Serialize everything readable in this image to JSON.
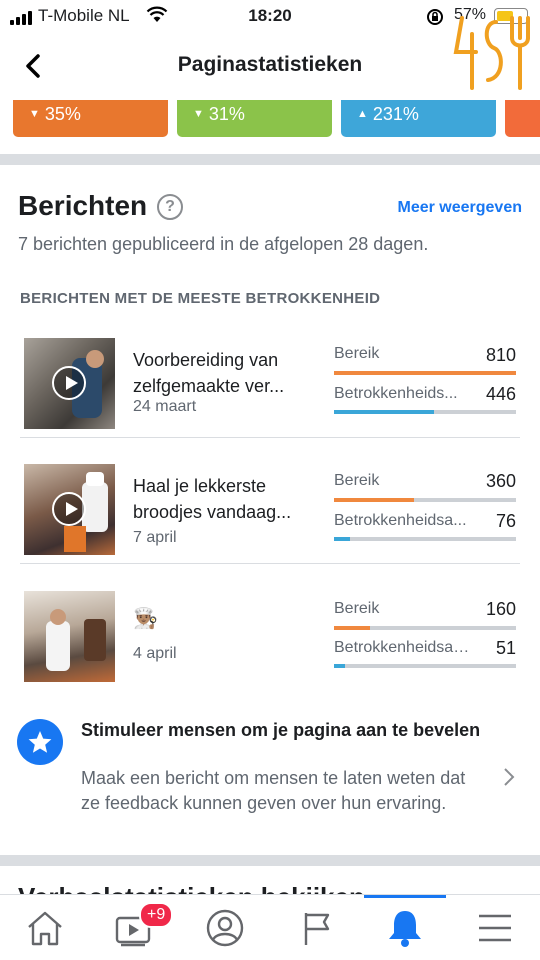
{
  "status_bar": {
    "carrier": "T-Mobile NL",
    "time": "18:20",
    "battery_percent": "57%",
    "battery_level": 0.57
  },
  "header": {
    "title": "Paginastatistieken"
  },
  "metric_chips": [
    {
      "value": "35%",
      "direction": "down",
      "color": "#e8772e"
    },
    {
      "value": "31%",
      "direction": "down",
      "color": "#8bc34a"
    },
    {
      "value": "231%",
      "direction": "up",
      "color": "#3ea6d9"
    },
    {
      "value": "",
      "direction": "",
      "color": "#f26b3a"
    }
  ],
  "posts_section": {
    "title": "Berichten",
    "more_link": "Meer weergeven",
    "subtitle": "7 berichten gepubliceerd in de afgelopen 28 dagen.",
    "top_header": "BERICHTEN MET DE MEESTE BETROKKENHEID",
    "reach_color": "#f0883e",
    "engagement_color": "#3aa6d8",
    "posts": [
      {
        "title_line1": "Voorbereiding van",
        "title_line2": "zelfgemaakte ver...",
        "date": "24 maart",
        "reach_label": "Bereik",
        "reach": "810",
        "reach_fraction": 1.0,
        "engagement_label": "Betrokkenheids...",
        "engagement": "446",
        "engagement_fraction": 0.55
      },
      {
        "title_line1": "Haal je lekkerste",
        "title_line2": "broodjes vandaag...",
        "date": "7 april",
        "reach_label": "Bereik",
        "reach": "360",
        "reach_fraction": 0.44,
        "engagement_label": "Betrokkenheidsa...",
        "engagement": "76",
        "engagement_fraction": 0.09
      },
      {
        "title_line1": "",
        "title_line2": "",
        "emoji": "👨🏽‍🍳",
        "date": "4 april",
        "reach_label": "Bereik",
        "reach": "160",
        "reach_fraction": 0.2,
        "engagement_label": "Betrokkenheidsac...",
        "engagement": "51",
        "engagement_fraction": 0.06
      }
    ]
  },
  "prompt_card": {
    "title": "Stimuleer mensen om je pagina aan te bevelen",
    "body": "Maak een bericht om mensen te laten weten dat ze feedback kunnen geven over hun ervaring.",
    "icon": "star-icon"
  },
  "next_section": {
    "title": "Verhaalstatistieken bekijken"
  },
  "tab_bar": {
    "tabs": [
      "home-icon",
      "video-icon",
      "profile-icon",
      "flag-icon",
      "bell-icon",
      "menu-icon"
    ],
    "active": "bell-icon",
    "video_badge": "+9"
  }
}
